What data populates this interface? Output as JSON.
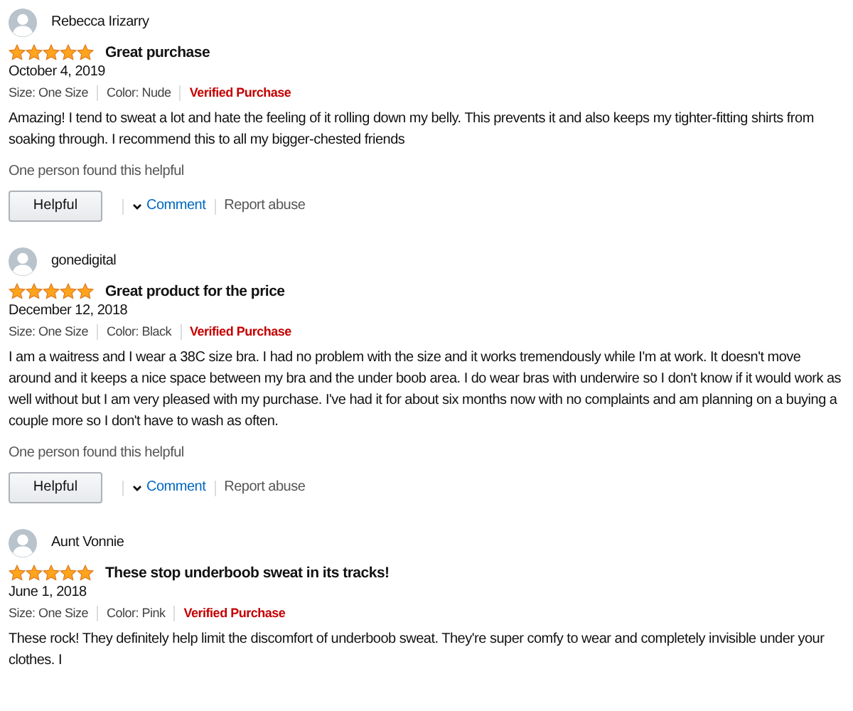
{
  "reviews": [
    {
      "author": "Rebecca Irizarry",
      "stars": 5,
      "title": "Great purchase",
      "date": "October 4, 2019",
      "size": "Size: One Size",
      "color_option": "Color: Nude",
      "verified_label": "Verified Purchase",
      "body": "Amazing! I tend to sweat a lot and hate the feeling of it rolling down my belly. This prevents it and also keeps my tighter-fitting shirts from soaking through. I recommend this to all my bigger-chested friends",
      "helpful_count": "One person found this helpful",
      "actions": {
        "helpful": "Helpful",
        "comment": "Comment",
        "report": "Report abuse"
      }
    },
    {
      "author": "gonedigital",
      "stars": 5,
      "title": "Great product for the price",
      "date": "December 12, 2018",
      "size": "Size: One Size",
      "color_option": "Color: Black",
      "verified_label": "Verified Purchase",
      "body": "I am a waitress and I wear a 38C size bra. I had no problem with the size and it works tremendously while I'm at work. It doesn't move around and it keeps a nice space between my bra and the under boob area. I do wear bras with underwire so I don't know if it would work as well without but I am very pleased with my purchase. I've had it for about six months now with no complaints and am planning on a buying a couple more so I don't have to wash as often.",
      "helpful_count": "One person found this helpful",
      "actions": {
        "helpful": "Helpful",
        "comment": "Comment",
        "report": "Report abuse"
      }
    },
    {
      "author": "Aunt Vonnie",
      "stars": 5,
      "title": "These stop underboob sweat in its tracks!",
      "date": "June 1, 2018",
      "size": "Size: One Size",
      "color_option": "Color: Pink",
      "verified_label": "Verified Purchase",
      "body": "These rock! They definitely help limit the discomfort of underboob sweat. They're super comfy to wear and completely invisible under your clothes. I"
    }
  ]
}
